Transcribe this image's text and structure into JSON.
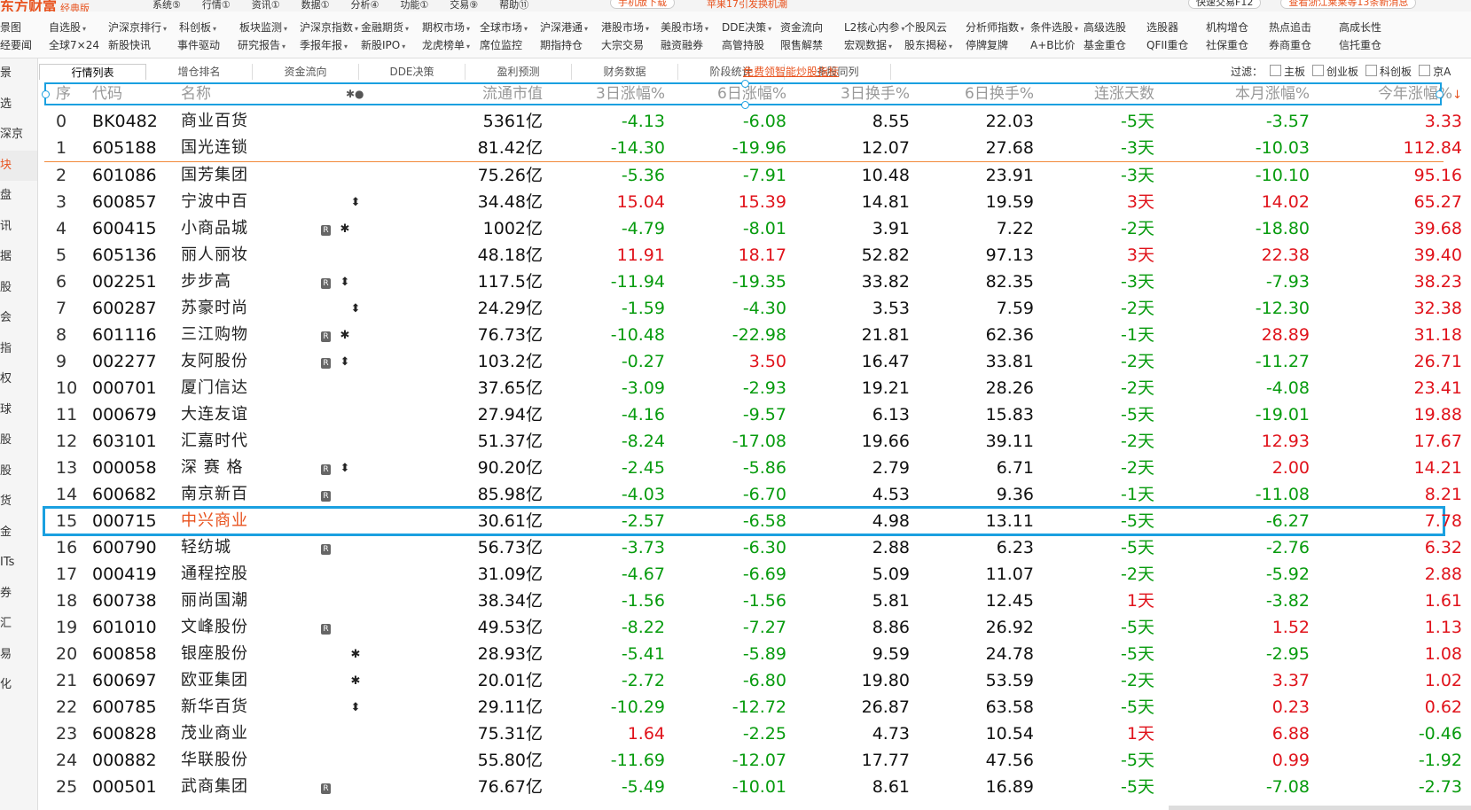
{
  "app": {
    "logo": "东方财富",
    "edition": "经典版"
  },
  "top_menu": [
    "系统⑤",
    "行情①",
    "资讯①",
    "数据①",
    "分析④",
    "功能①",
    "交易⑨",
    "帮助⑪"
  ],
  "top_right": {
    "mobile": "手机版下载",
    "promo": "苹果17引发换机潮",
    "quick_trade": "快速交易F12",
    "news": "查看浙江莱莱等13条新消息"
  },
  "menu_row1": [
    "景图",
    "自选股",
    "沪深京排行",
    "科创板",
    "板块监测",
    "沪深京指数",
    "金融期货",
    "期权市场",
    "全球市场",
    "沪深港通",
    "港股市场",
    "美股市场",
    "DDE决策",
    "资金流向",
    "L2核心内参",
    "个股风云",
    "分析师指数",
    "条件选股",
    "高级选股",
    "选股器",
    "机构增仓",
    "热点追击",
    "高成长性"
  ],
  "menu_row2": [
    "经要闻",
    "全球7×24",
    "新股快讯",
    "事件驱动",
    "研究报告",
    "季报年报",
    "新股IPO",
    "龙虎榜单",
    "席位监控",
    "期指持仓",
    "大宗交易",
    "融资融券",
    "高管持股",
    "限售解禁",
    "宏观数据",
    "股东揭秘",
    "停牌复牌",
    "A+B比价",
    "基金重仓",
    "QFII重仓",
    "社保重仓",
    "券商重仓",
    "信托重仓"
  ],
  "sidebar": [
    "景",
    "选",
    "深京",
    "块",
    "盘",
    "讯",
    "据",
    "股",
    "会",
    "指",
    "权",
    "球",
    "股",
    "股",
    "货",
    "金",
    "ITs",
    "券",
    "汇",
    "易",
    "化"
  ],
  "subtabs": [
    "行情列表",
    "增仓排名",
    "资金流向",
    "DDE决策",
    "盈利预测",
    "财务数据",
    "阶段统计",
    "多股同列"
  ],
  "promo_link": "免费领智能炒股指标",
  "filter": {
    "label": "过滤：",
    "options": [
      "主板",
      "创业板",
      "科创板",
      "京A"
    ]
  },
  "columns": {
    "seq": "序",
    "code": "代码",
    "name": "名称",
    "icons": "✱●",
    "mcap": "流通市值",
    "r3": "3日涨幅%",
    "r6": "6日涨幅%",
    "t3": "3日换手%",
    "t6": "6日换手%",
    "days": "连涨天数",
    "month": "本月涨幅%",
    "year": "今年涨幅%",
    "sort_arrow": "↓"
  },
  "rows": [
    {
      "seq": "0",
      "code": "BK0482",
      "name": "商业百货",
      "r": false,
      "s": "",
      "mcap": "5361亿",
      "r3": "-4.13",
      "r6": "-6.08",
      "t3": "8.55",
      "t6": "22.03",
      "days": "-5天",
      "month": "-3.57",
      "year": "3.33"
    },
    {
      "seq": "1",
      "code": "605188",
      "name": "国光连锁",
      "r": false,
      "s": "",
      "mcap": "81.42亿",
      "r3": "-14.30",
      "r6": "-19.96",
      "t3": "12.07",
      "t6": "27.68",
      "days": "-3天",
      "month": "-10.03",
      "year": "112.84"
    },
    {
      "seq": "2",
      "code": "601086",
      "name": "国芳集团",
      "r": false,
      "s": "",
      "mcap": "75.26亿",
      "r3": "-5.36",
      "r6": "-7.91",
      "t3": "10.48",
      "t6": "23.91",
      "days": "-3天",
      "month": "-10.10",
      "year": "95.16"
    },
    {
      "seq": "3",
      "code": "600857",
      "name": "宁波中百",
      "r": false,
      "s": "⬍",
      "mcap": "34.48亿",
      "r3": "15.04",
      "r6": "15.39",
      "t3": "14.81",
      "t6": "19.59",
      "days": "3天",
      "month": "14.02",
      "year": "65.27"
    },
    {
      "seq": "4",
      "code": "600415",
      "name": "小商品城",
      "r": true,
      "s": "✱",
      "mcap": "1002亿",
      "r3": "-4.79",
      "r6": "-8.01",
      "t3": "3.91",
      "t6": "7.22",
      "days": "-2天",
      "month": "-18.80",
      "year": "39.68"
    },
    {
      "seq": "5",
      "code": "605136",
      "name": "丽人丽妆",
      "r": false,
      "s": "",
      "mcap": "48.18亿",
      "r3": "11.91",
      "r6": "18.17",
      "t3": "52.82",
      "t6": "97.13",
      "days": "3天",
      "month": "22.38",
      "year": "39.40"
    },
    {
      "seq": "6",
      "code": "002251",
      "name": "步步高",
      "r": true,
      "s": "⬍",
      "mcap": "117.5亿",
      "r3": "-11.94",
      "r6": "-19.35",
      "t3": "33.82",
      "t6": "82.35",
      "days": "-3天",
      "month": "-7.93",
      "year": "38.23"
    },
    {
      "seq": "7",
      "code": "600287",
      "name": "苏豪时尚",
      "r": false,
      "s": "⬍",
      "mcap": "24.29亿",
      "r3": "-1.59",
      "r6": "-4.30",
      "t3": "3.53",
      "t6": "7.59",
      "days": "-2天",
      "month": "-12.30",
      "year": "32.38"
    },
    {
      "seq": "8",
      "code": "601116",
      "name": "三江购物",
      "r": true,
      "s": "✱",
      "mcap": "76.73亿",
      "r3": "-10.48",
      "r6": "-22.98",
      "t3": "21.81",
      "t6": "62.36",
      "days": "-1天",
      "month": "28.89",
      "year": "31.18"
    },
    {
      "seq": "9",
      "code": "002277",
      "name": "友阿股份",
      "r": true,
      "s": "⬍",
      "mcap": "103.2亿",
      "r3": "-0.27",
      "r6": "3.50",
      "t3": "16.47",
      "t6": "33.81",
      "days": "-2天",
      "month": "-11.27",
      "year": "26.71"
    },
    {
      "seq": "10",
      "code": "000701",
      "name": "厦门信达",
      "r": false,
      "s": "",
      "mcap": "37.65亿",
      "r3": "-3.09",
      "r6": "-2.93",
      "t3": "19.21",
      "t6": "28.26",
      "days": "-2天",
      "month": "-4.08",
      "year": "23.41"
    },
    {
      "seq": "11",
      "code": "000679",
      "name": "大连友谊",
      "r": false,
      "s": "",
      "mcap": "27.94亿",
      "r3": "-4.16",
      "r6": "-9.57",
      "t3": "6.13",
      "t6": "15.83",
      "days": "-5天",
      "month": "-19.01",
      "year": "19.88"
    },
    {
      "seq": "12",
      "code": "603101",
      "name": "汇嘉时代",
      "r": false,
      "s": "",
      "mcap": "51.37亿",
      "r3": "-8.24",
      "r6": "-17.08",
      "t3": "19.66",
      "t6": "39.11",
      "days": "-2天",
      "month": "12.93",
      "year": "17.67"
    },
    {
      "seq": "13",
      "code": "000058",
      "name": "深 赛 格",
      "r": true,
      "s": "⬍",
      "mcap": "90.20亿",
      "r3": "-2.45",
      "r6": "-5.86",
      "t3": "2.79",
      "t6": "6.71",
      "days": "-2天",
      "month": "2.00",
      "year": "14.21"
    },
    {
      "seq": "14",
      "code": "600682",
      "name": "南京新百",
      "r": true,
      "s": "",
      "mcap": "85.98亿",
      "r3": "-4.03",
      "r6": "-6.70",
      "t3": "4.53",
      "t6": "9.36",
      "days": "-1天",
      "month": "-11.08",
      "year": "8.21"
    },
    {
      "seq": "15",
      "code": "000715",
      "name": "中兴商业",
      "r": false,
      "s": "",
      "mcap": "30.61亿",
      "r3": "-2.57",
      "r6": "-6.58",
      "t3": "4.98",
      "t6": "13.11",
      "days": "-5天",
      "month": "-6.27",
      "year": "7.78"
    },
    {
      "seq": "16",
      "code": "600790",
      "name": "轻纺城",
      "r": true,
      "s": "",
      "mcap": "56.73亿",
      "r3": "-3.73",
      "r6": "-6.30",
      "t3": "2.88",
      "t6": "6.23",
      "days": "-5天",
      "month": "-2.76",
      "year": "6.32"
    },
    {
      "seq": "17",
      "code": "000419",
      "name": "通程控股",
      "r": false,
      "s": "",
      "mcap": "31.09亿",
      "r3": "-4.67",
      "r6": "-6.69",
      "t3": "5.09",
      "t6": "11.07",
      "days": "-2天",
      "month": "-5.92",
      "year": "2.88"
    },
    {
      "seq": "18",
      "code": "600738",
      "name": "丽尚国潮",
      "r": false,
      "s": "",
      "mcap": "38.34亿",
      "r3": "-1.56",
      "r6": "-1.56",
      "t3": "5.81",
      "t6": "12.45",
      "days": "1天",
      "month": "-3.82",
      "year": "1.61"
    },
    {
      "seq": "19",
      "code": "601010",
      "name": "文峰股份",
      "r": true,
      "s": "",
      "mcap": "49.53亿",
      "r3": "-8.22",
      "r6": "-7.27",
      "t3": "8.86",
      "t6": "26.92",
      "days": "-5天",
      "month": "1.52",
      "year": "1.13"
    },
    {
      "seq": "20",
      "code": "600858",
      "name": "银座股份",
      "r": false,
      "s": "✱",
      "mcap": "28.93亿",
      "r3": "-5.41",
      "r6": "-5.89",
      "t3": "9.59",
      "t6": "24.78",
      "days": "-5天",
      "month": "-2.95",
      "year": "1.08"
    },
    {
      "seq": "21",
      "code": "600697",
      "name": "欧亚集团",
      "r": false,
      "s": "✱",
      "mcap": "20.01亿",
      "r3": "-2.72",
      "r6": "-6.80",
      "t3": "19.80",
      "t6": "53.59",
      "days": "-2天",
      "month": "3.37",
      "year": "1.02"
    },
    {
      "seq": "22",
      "code": "600785",
      "name": "新华百货",
      "r": false,
      "s": "⬍",
      "mcap": "29.11亿",
      "r3": "-10.29",
      "r6": "-12.72",
      "t3": "26.87",
      "t6": "63.58",
      "days": "-5天",
      "month": "0.23",
      "year": "0.62"
    },
    {
      "seq": "23",
      "code": "600828",
      "name": "茂业商业",
      "r": false,
      "s": "",
      "mcap": "75.31亿",
      "r3": "1.64",
      "r6": "-2.25",
      "t3": "4.73",
      "t6": "10.54",
      "days": "1天",
      "month": "6.88",
      "year": "-0.46"
    },
    {
      "seq": "24",
      "code": "000882",
      "name": "华联股份",
      "r": false,
      "s": "",
      "mcap": "55.80亿",
      "r3": "-11.69",
      "r6": "-12.07",
      "t3": "17.77",
      "t6": "47.56",
      "days": "-5天",
      "month": "0.99",
      "year": "-1.92"
    },
    {
      "seq": "25",
      "code": "000501",
      "name": "武商集团",
      "r": true,
      "s": "",
      "mcap": "76.67亿",
      "r3": "-5.49",
      "r6": "-10.01",
      "t3": "8.61",
      "t6": "16.89",
      "days": "-5天",
      "month": "-7.08",
      "year": "-2.73"
    }
  ],
  "r_badge": "R",
  "colors": {
    "up": "#e0131b",
    "down": "#079b0e",
    "selection": "#1aa0e0",
    "brand": "#e8531f"
  }
}
